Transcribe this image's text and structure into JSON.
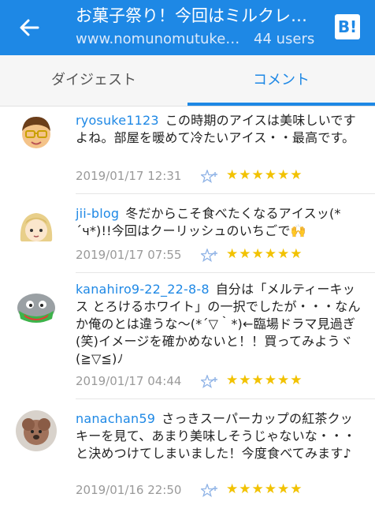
{
  "header": {
    "title": "お菓子祭り！今回はミルクレープ",
    "subtitle": "www.nomunomutukei.jp",
    "users": "44 users",
    "logo": "B!",
    "colors": {
      "bar": "#1e88e5",
      "star": "#f2c200"
    }
  },
  "tabs": [
    {
      "label": "ダイジェスト",
      "active": false
    },
    {
      "label": "コメント",
      "active": true
    }
  ],
  "comments": [
    {
      "user": "ryosuke1123",
      "text": "この時期のアイスは美味しいですよね。部屋を暖めて冷たいアイス・・最高です。",
      "date": "2019/01/17 12:31",
      "stars": "★★★★★★",
      "add_star_icon": "add-star-icon"
    },
    {
      "user": "jii-blog",
      "text": "冬だからこそ食べたくなるアイスッ(*´ч*)!!今回はクーリッシュのいちごで🙌",
      "date": "2019/01/17 07:55",
      "stars": "★★★★★★",
      "add_star_icon": "add-star-icon"
    },
    {
      "user": "kanahiro9-22_22-8-8",
      "text": "自分は「メルティーキッス とろけるホワイト」の一択でしたが・・・なんか俺のとは違うな〜(*´▽｀*)←臨場ドラマ見過ぎ(笑)イメージを確かめないと！！買ってみようヾ(≧▽≦)ﾉ",
      "date": "2019/01/17 04:44",
      "stars": "★★★★★★",
      "add_star_icon": "add-star-icon"
    },
    {
      "user": "nanachan59",
      "text": "さっきスーパーカップの紅茶クッキーを見て、あまり美味しそうじゃないな・・・と決めつけてしまいました！今度食べてみます♪",
      "date": "2019/01/16 22:50",
      "stars": "★★★★★★",
      "add_star_icon": "add-star-icon"
    }
  ]
}
